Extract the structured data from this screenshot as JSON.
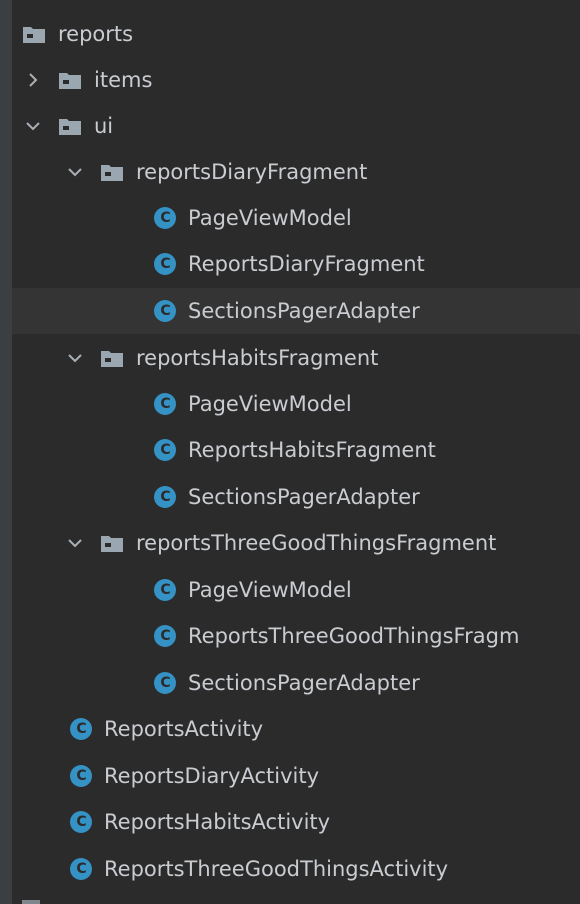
{
  "tree": {
    "root": {
      "label": "reports",
      "icon": "folder-icon"
    },
    "items_folder": {
      "label": "items",
      "icon": "folder-icon",
      "expanded": false
    },
    "ui_folder": {
      "label": "ui",
      "icon": "folder-icon",
      "expanded": true
    },
    "diary_folder": {
      "label": "reportsDiaryFragment",
      "icon": "folder-icon",
      "expanded": true
    },
    "diary_page_view_model": {
      "label": "PageViewModel",
      "icon": "class-icon",
      "icon_letter": "C"
    },
    "diary_fragment": {
      "label": "ReportsDiaryFragment",
      "icon": "class-icon",
      "icon_letter": "C"
    },
    "diary_sections_pager_adapter": {
      "label": "SectionsPagerAdapter",
      "icon": "class-icon",
      "icon_letter": "C",
      "selected": true
    },
    "habits_folder": {
      "label": "reportsHabitsFragment",
      "icon": "folder-icon",
      "expanded": true
    },
    "habits_page_view_model": {
      "label": "PageViewModel",
      "icon": "class-icon",
      "icon_letter": "C"
    },
    "habits_fragment": {
      "label": "ReportsHabitsFragment",
      "icon": "class-icon",
      "icon_letter": "C"
    },
    "habits_sections_pager_adapter": {
      "label": "SectionsPagerAdapter",
      "icon": "class-icon",
      "icon_letter": "C"
    },
    "three_good_things_folder": {
      "label": "reportsThreeGoodThingsFragment",
      "icon": "folder-icon",
      "expanded": true
    },
    "tgt_page_view_model": {
      "label": "PageViewModel",
      "icon": "class-icon",
      "icon_letter": "C"
    },
    "tgt_fragment": {
      "label": "ReportsThreeGoodThingsFragm",
      "icon": "class-icon",
      "icon_letter": "C"
    },
    "tgt_sections_pager_adapter": {
      "label": "SectionsPagerAdapter",
      "icon": "class-icon",
      "icon_letter": "C"
    },
    "reports_activity": {
      "label": "ReportsActivity",
      "icon": "class-icon",
      "icon_letter": "C"
    },
    "reports_diary_activity": {
      "label": "ReportsDiaryActivity",
      "icon": "class-icon",
      "icon_letter": "C"
    },
    "reports_habits_activity": {
      "label": "ReportsHabitsActivity",
      "icon": "class-icon",
      "icon_letter": "C"
    },
    "reports_tgt_activity": {
      "label": "ReportsThreeGoodThingsActivity",
      "icon": "class-icon",
      "icon_letter": "C"
    }
  },
  "colors": {
    "background": "#2b2b2b",
    "selected_row": "#343434",
    "text": "#c9ccd1",
    "folder": "#9aa7b0",
    "class_icon": "#3592c4",
    "chevron": "#a9b0b6"
  }
}
